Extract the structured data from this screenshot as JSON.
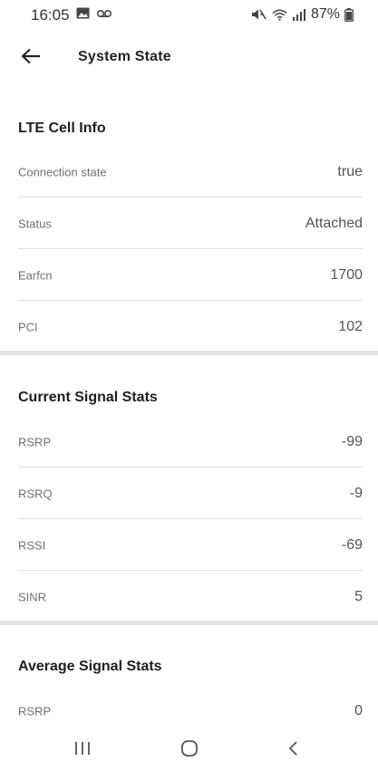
{
  "status_bar": {
    "time": "16:05",
    "battery": "87%",
    "left_icons": [
      "gallery-icon",
      "voicemail-icon"
    ],
    "right_icons": [
      "mute-icon",
      "wifi-icon",
      "signal-icon",
      "battery-icon"
    ]
  },
  "app_bar": {
    "back_icon": "arrow-left-icon",
    "title": "System State"
  },
  "sections": {
    "lte_cell_info": {
      "title": "LTE Cell Info",
      "rows": [
        {
          "label": "Connection state",
          "value": "true"
        },
        {
          "label": "Status",
          "value": "Attached"
        },
        {
          "label": "Earfcn",
          "value": "1700"
        },
        {
          "label": "PCI",
          "value": "102"
        }
      ]
    },
    "current_signal_stats": {
      "title": "Current Signal Stats",
      "rows": [
        {
          "label": "RSRP",
          "value": "-99"
        },
        {
          "label": "RSRQ",
          "value": "-9"
        },
        {
          "label": "RSSI",
          "value": "-69"
        },
        {
          "label": "SINR",
          "value": "5"
        }
      ]
    },
    "average_signal_stats": {
      "title": "Average Signal Stats",
      "rows": [
        {
          "label": "RSRP",
          "value": "0"
        }
      ]
    }
  },
  "nav_bar": {
    "icons": [
      "recents-icon",
      "home-icon",
      "back-icon"
    ]
  }
}
